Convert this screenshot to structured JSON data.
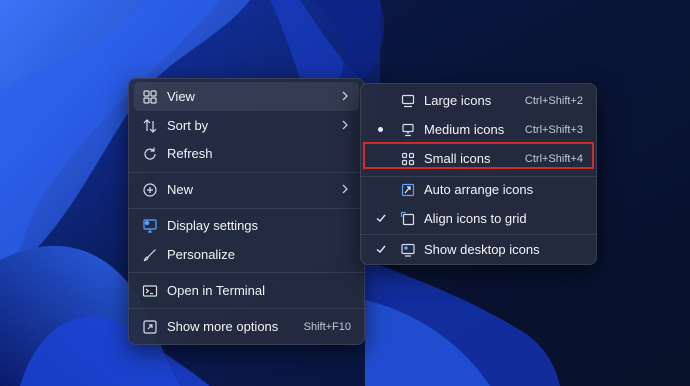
{
  "main_menu": {
    "items": [
      {
        "label": "View",
        "icon": "view-grid-icon",
        "has_submenu": true
      },
      {
        "label": "Sort by",
        "icon": "sort-arrows-icon",
        "has_submenu": true
      },
      {
        "label": "Refresh",
        "icon": "refresh-icon"
      },
      {
        "label": "New",
        "icon": "plus-circle-icon",
        "has_submenu": true
      },
      {
        "label": "Display settings",
        "icon": "display-settings-icon"
      },
      {
        "label": "Personalize",
        "icon": "brush-icon"
      },
      {
        "label": "Open in Terminal",
        "icon": "terminal-icon"
      },
      {
        "label": "Show more options",
        "icon": "more-options-icon",
        "shortcut": "Shift+F10"
      }
    ]
  },
  "view_submenu": {
    "items": [
      {
        "label": "Large icons",
        "icon": "monitor-icon",
        "shortcut": "Ctrl+Shift+2",
        "selected": false
      },
      {
        "label": "Medium icons",
        "icon": "monitor-stand-icon",
        "shortcut": "Ctrl+Shift+3",
        "selected": true
      },
      {
        "label": "Small icons",
        "icon": "small-grid-icon",
        "shortcut": "Ctrl+Shift+4",
        "selected": false,
        "highlighted": true
      },
      {
        "label": "Auto arrange icons",
        "icon": "auto-arrange-icon",
        "checked": false
      },
      {
        "label": "Align icons to grid",
        "icon": "align-grid-icon",
        "checked": true
      },
      {
        "label": "Show desktop icons",
        "icon": "desktop-icon",
        "checked": true
      }
    ]
  },
  "colors": {
    "menu_bg": "#262c40",
    "highlight_border": "#d02a2a",
    "wallpaper_accent": "#1f4fe0"
  }
}
